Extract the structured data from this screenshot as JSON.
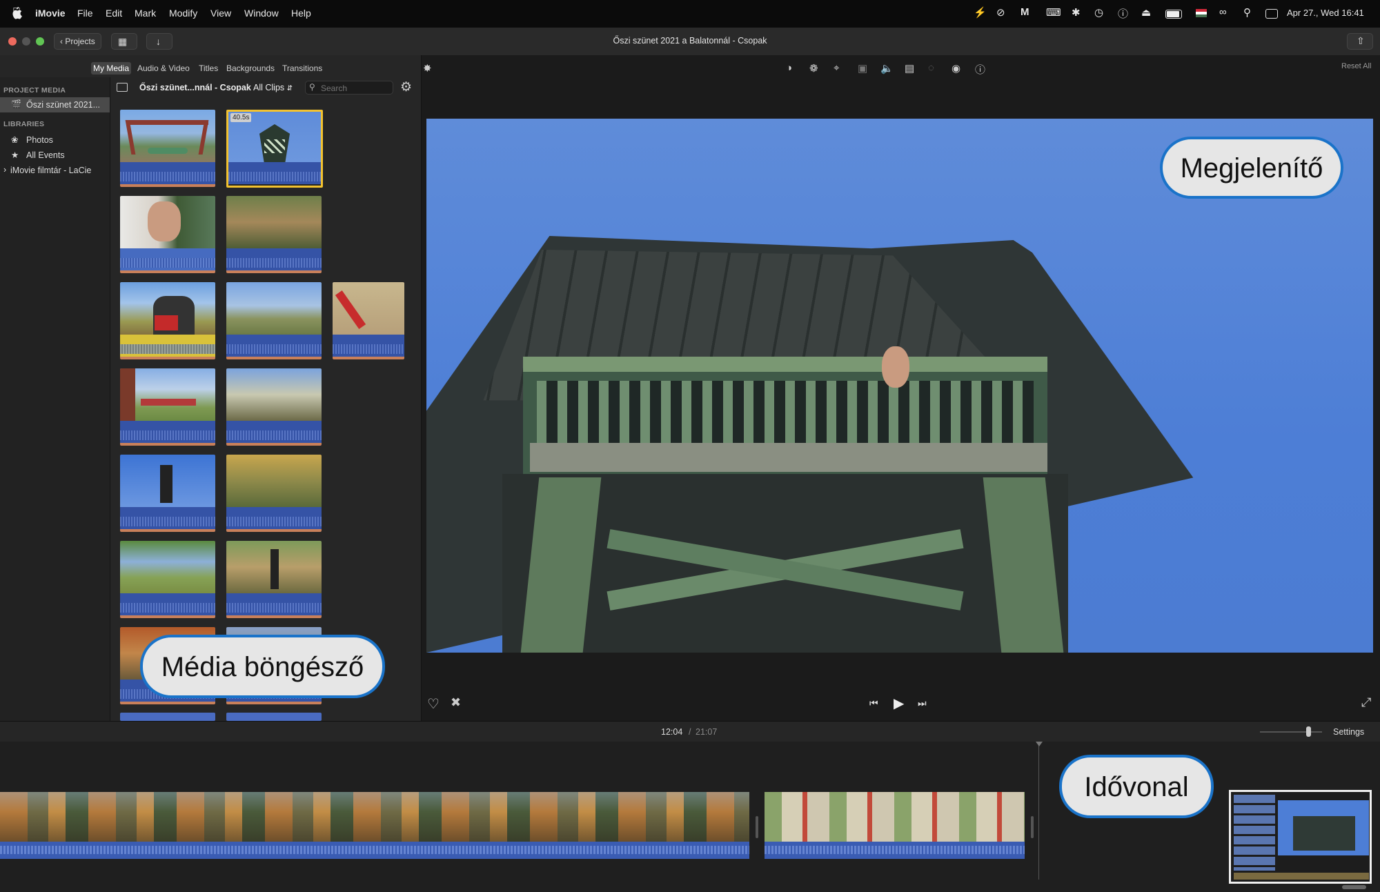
{
  "menubar": {
    "app_name": "iMovie",
    "items": [
      "File",
      "Edit",
      "Mark",
      "Modify",
      "View",
      "Window",
      "Help"
    ],
    "datetime": "Apr 27., Wed  16:41"
  },
  "titlebar": {
    "projects_label": "Projects",
    "window_title": "Őszi szünet 2021 a Balatonnál - Csopak"
  },
  "browser": {
    "tabs": [
      {
        "label": "My Media"
      },
      {
        "label": "Audio & Video"
      },
      {
        "label": "Titles"
      },
      {
        "label": "Backgrounds"
      },
      {
        "label": "Transitions"
      }
    ],
    "active_tab": "My Media",
    "sidebar": {
      "project_media_header": "PROJECT MEDIA",
      "project_item": "Őszi szünet 2021...",
      "libraries_header": "LIBRARIES",
      "photos": "Photos",
      "all_events": "All Events",
      "library": "iMovie filmtár - LaCie"
    },
    "toolbar": {
      "event_name": "Őszi szünet...nnál - Csopak",
      "filter": "All Clips",
      "search_placeholder": "Search"
    },
    "selected_clip_duration": "40.5s"
  },
  "viewer": {
    "reset_all": "Reset All"
  },
  "timeline": {
    "current_time": "12:04",
    "separator": "/",
    "total_time": "21:07",
    "settings_label": "Settings"
  },
  "callouts": {
    "viewer": "Megjelenítő",
    "browser": "Média böngésző",
    "timeline": "Idővonal"
  },
  "colors": {
    "selection": "#f2c230",
    "callout_border": "#1a73c9",
    "audio_wave": "#3553a6"
  }
}
